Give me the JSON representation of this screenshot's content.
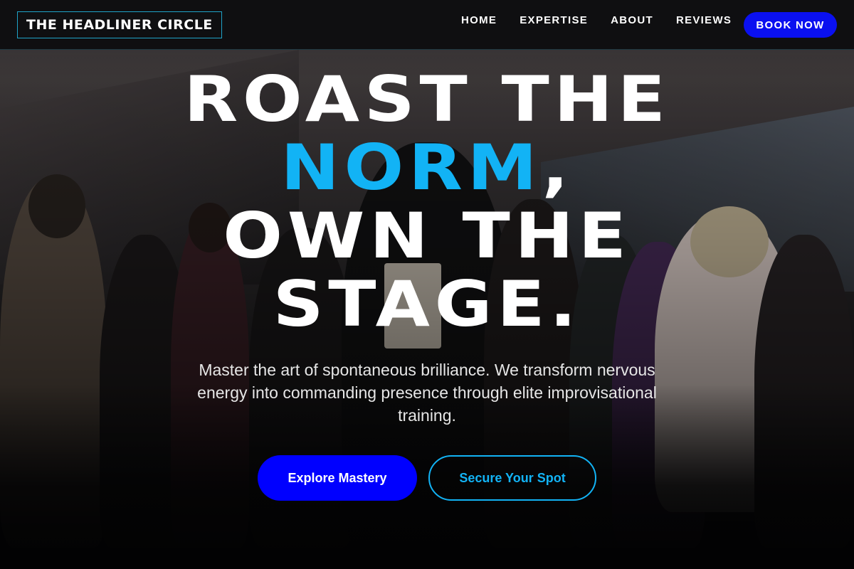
{
  "header": {
    "logo_text": "THE HEADLINER CIRCLE",
    "nav": [
      {
        "label": "HOME"
      },
      {
        "label": "EXPERTISE"
      },
      {
        "label": "ABOUT"
      },
      {
        "label": "REVIEWS"
      }
    ],
    "book_label": "BOOK NOW"
  },
  "hero": {
    "headline_line1": "ROAST THE",
    "headline_accent": "NORM",
    "headline_comma": ",",
    "headline_line3": "OWN THE",
    "headline_line4": "STAGE.",
    "subtext": "Master the art of spontaneous brilliance. We transform nervous energy into commanding presence through elite improvisational training.",
    "primary_cta": "Explore Mastery",
    "secondary_cta": "Secure Your Spot"
  },
  "colors": {
    "accent_cyan": "#12b3f5",
    "primary_blue": "#0000ff",
    "header_bg": "#0c0c0e"
  }
}
